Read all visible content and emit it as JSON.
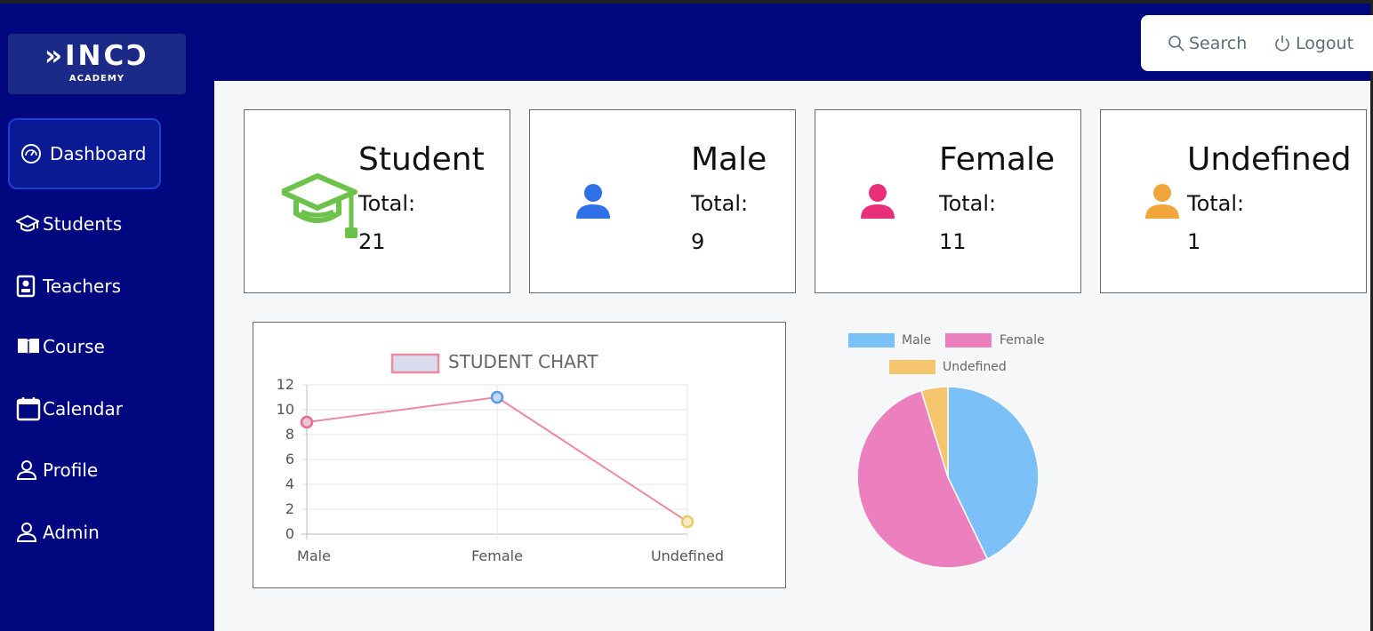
{
  "logo": {
    "main": "»INCↃ",
    "sub": "ACADEMY"
  },
  "sidebar": {
    "items": [
      {
        "label": "Dashboard",
        "icon": "dashboard-icon",
        "active": true
      },
      {
        "label": "Students",
        "icon": "graduation-cap-icon"
      },
      {
        "label": "Teachers",
        "icon": "id-badge-icon"
      },
      {
        "label": "Course",
        "icon": "book-icon"
      },
      {
        "label": "Calendar",
        "icon": "calendar-icon"
      },
      {
        "label": "Profile",
        "icon": "user-icon"
      },
      {
        "label": "Admin",
        "icon": "user-icon"
      }
    ]
  },
  "header": {
    "search_label": "Search",
    "logout_label": "Logout"
  },
  "cards": [
    {
      "title": "Student",
      "total_label": "Total:",
      "value": "21",
      "icon": "graduation-cap-icon",
      "color": "#6cc24a"
    },
    {
      "title": "Male",
      "total_label": "Total:",
      "value": "9",
      "icon": "user-icon",
      "color": "#2f6fe8"
    },
    {
      "title": "Female",
      "total_label": "Total:",
      "value": "11",
      "icon": "user-icon",
      "color": "#ea2f7a"
    },
    {
      "title": "Undefined",
      "total_label": "Total:",
      "value": "1",
      "icon": "user-icon",
      "color": "#f2a53a"
    }
  ],
  "colors": {
    "sidebar_bg": "#01087f",
    "line": "#ec8aa0",
    "male": "#7cc0f8",
    "female": "#ec7fbd",
    "undefined": "#f5c56e"
  },
  "chart_data": [
    {
      "type": "line",
      "title": "STUDENT CHART",
      "legend": [
        "STUDENT CHART"
      ],
      "categories": [
        "Male",
        "Female",
        "Undefined"
      ],
      "values": [
        9,
        11,
        1
      ],
      "ylim": [
        0,
        12
      ],
      "yticks": [
        0,
        2,
        4,
        6,
        8,
        10,
        12
      ],
      "grid": true
    },
    {
      "type": "pie",
      "categories": [
        "Male",
        "Female",
        "Undefined"
      ],
      "values": [
        9,
        11,
        1
      ],
      "legend": "top"
    }
  ]
}
